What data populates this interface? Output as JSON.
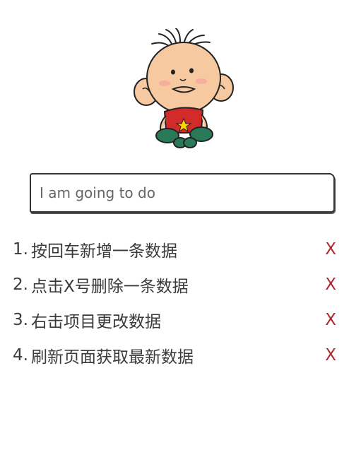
{
  "input": {
    "placeholder": "I am going to do"
  },
  "todos": [
    {
      "num": "1.",
      "text": "按回车新增一条数据",
      "delete": "X"
    },
    {
      "num": "2.",
      "text": "点击X号删除一条数据",
      "delete": "X"
    },
    {
      "num": "3.",
      "text": "右击项目更改数据",
      "delete": "X"
    },
    {
      "num": "4.",
      "text": "刷新页面获取最新数据",
      "delete": "X"
    }
  ],
  "colors": {
    "delete": "#b0262b",
    "text": "#3a3a3a"
  }
}
